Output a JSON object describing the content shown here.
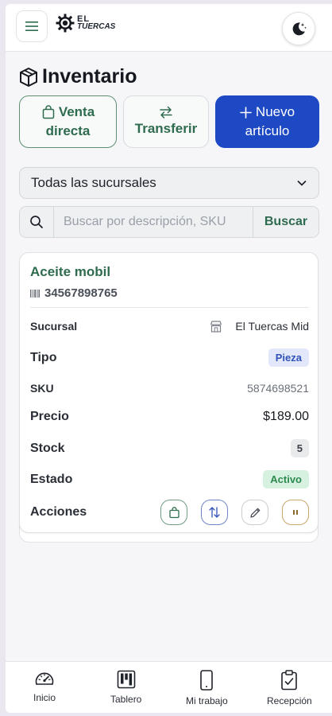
{
  "header": {
    "logo_top": "EL",
    "logo_bottom": "TUERCAS"
  },
  "page": {
    "title": "Inventario"
  },
  "actions": {
    "sale_line1": "Venta",
    "sale_line2": "directa",
    "transfer": "Transferir",
    "new_line1": "Nuevo",
    "new_line2": "artículo"
  },
  "filters": {
    "branch_selected": "Todas las sucursales",
    "search_placeholder": "Buscar por descripción, SKU",
    "search_button": "Buscar"
  },
  "item": {
    "name": "Aceite mobil",
    "barcode": "34567898765",
    "rows": {
      "branch_label": "Sucursal",
      "branch_value": "El Tuercas Mid",
      "type_label": "Tipo",
      "type_value": "Pieza",
      "sku_label": "SKU",
      "sku_value": "5874698521",
      "price_label": "Precio",
      "price_value": "$189.00",
      "stock_label": "Stock",
      "stock_value": "5",
      "status_label": "Estado",
      "status_value": "Activo",
      "actions_label": "Acciones"
    }
  },
  "nav": {
    "home": "Inicio",
    "board": "Tablero",
    "mywork": "Mi trabajo",
    "reception": "Recepción"
  },
  "colors": {
    "brand_green": "#2f6b4e",
    "primary_blue": "#1e49c4",
    "status_active": "#2d8a4f"
  }
}
